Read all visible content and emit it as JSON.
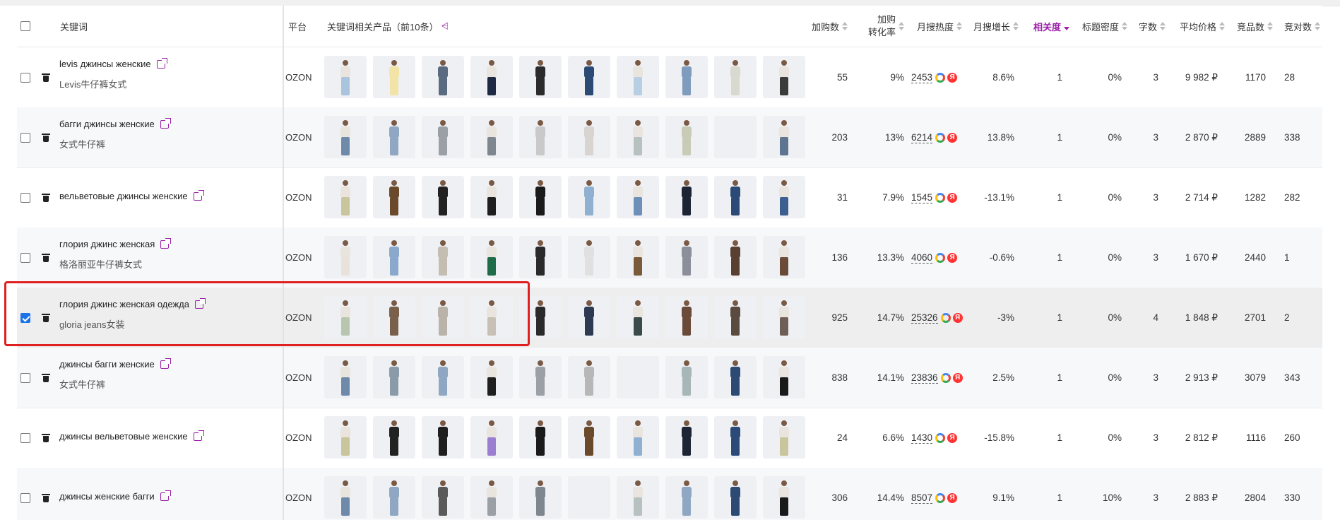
{
  "header": {
    "keyword": "关键词",
    "platform": "平台",
    "products": "关键词相关产品（前10条）",
    "add_to_cart": "加购数",
    "conversion_line1": "加购",
    "conversion_line2": "转化率",
    "monthly_heat": "月搜热度",
    "monthly_growth": "月搜增长",
    "relevance": "相关度",
    "title_density": "标题密度",
    "word_count": "字数",
    "avg_price": "平均价格",
    "competitors": "竞品数",
    "competition_ratio": "竞对数"
  },
  "rows": [
    {
      "keyword": "levis джинсы женские",
      "translation": "Levis牛仔裤女式",
      "platform": "OZON",
      "add": "55",
      "conv": "9%",
      "heat": "2453",
      "growth": "8.6%",
      "rel": "1",
      "density": "0%",
      "words": "3",
      "price": "9 982 ₽",
      "comp": "1170",
      "ratio": "28",
      "checked": false
    },
    {
      "keyword": "багги джинсы женские",
      "translation": "女式牛仔裤",
      "platform": "OZON",
      "add": "203",
      "conv": "13%",
      "heat": "6214",
      "growth": "13.8%",
      "rel": "1",
      "density": "0%",
      "words": "3",
      "price": "2 870 ₽",
      "comp": "2889",
      "ratio": "338",
      "checked": false
    },
    {
      "keyword": "вельветовые джинсы женские",
      "translation": "",
      "platform": "OZON",
      "add": "31",
      "conv": "7.9%",
      "heat": "1545",
      "growth": "-13.1%",
      "rel": "1",
      "density": "0%",
      "words": "3",
      "price": "2 714 ₽",
      "comp": "1282",
      "ratio": "282",
      "checked": false
    },
    {
      "keyword": "глория джинс женская",
      "translation": "格洛丽亚牛仔裤女式",
      "platform": "OZON",
      "add": "136",
      "conv": "13.3%",
      "heat": "4060",
      "growth": "-0.6%",
      "rel": "1",
      "density": "0%",
      "words": "3",
      "price": "1 670 ₽",
      "comp": "2440",
      "ratio": "1",
      "checked": false
    },
    {
      "keyword": "глория джинс женская одежда",
      "translation": "gloria jeans女装",
      "platform": "OZON",
      "add": "925",
      "conv": "14.7%",
      "heat": "25326",
      "growth": "-3%",
      "rel": "1",
      "density": "0%",
      "words": "4",
      "price": "1 848 ₽",
      "comp": "2701",
      "ratio": "2",
      "checked": true
    },
    {
      "keyword": "джинсы багги женские",
      "translation": "女式牛仔裤",
      "platform": "OZON",
      "add": "838",
      "conv": "14.1%",
      "heat": "23836",
      "growth": "2.5%",
      "rel": "1",
      "density": "0%",
      "words": "3",
      "price": "2 913 ₽",
      "comp": "3079",
      "ratio": "343",
      "checked": false
    },
    {
      "keyword": "джинсы вельветовые женские",
      "translation": "",
      "platform": "OZON",
      "add": "24",
      "conv": "6.6%",
      "heat": "1430",
      "growth": "-15.8%",
      "rel": "1",
      "density": "0%",
      "words": "3",
      "price": "2 812 ₽",
      "comp": "1116",
      "ratio": "260",
      "checked": false
    },
    {
      "keyword": "джинсы женские багги",
      "translation": "",
      "platform": "OZON",
      "add": "306",
      "conv": "14.4%",
      "heat": "8507",
      "growth": "9.1%",
      "rel": "1",
      "density": "10%",
      "words": "3",
      "price": "2 883 ₽",
      "comp": "2804",
      "ratio": "330",
      "checked": false
    }
  ],
  "thumb_palettes": [
    [
      "#a9c4dc",
      "#f2e4a6",
      "#5a6a80",
      "#1e2a44",
      "#2b2b2b",
      "#2d4a75",
      "#b8cfe3",
      "#7f9bbd",
      "#d9d9cf",
      "#3b3b3b"
    ],
    [
      "#6f8aa8",
      "#8fa7c2",
      "#9aa0a6",
      "#7e8690",
      "#c9c9c9",
      "#d8d4d0",
      "#b7c2c0",
      "#c9cbb6",
      "#eef0f3",
      "#5e7591"
    ],
    [
      "#c9c59c",
      "#6a4a2a",
      "#222",
      "#1f1f1f",
      "#1a1a1a",
      "#8fb0d0",
      "#6d8fb8",
      "#1d2433",
      "#2c4a78",
      "#3c5f8f"
    ],
    [
      "#e8e2da",
      "#8aa8cc",
      "#c4bdb2",
      "#1f6b4a",
      "#2a2a2a",
      "#e0e0e0",
      "#7a5a3a",
      "#8a8f99",
      "#5a4030",
      "#6a4a38"
    ],
    [
      "#b8c6b0",
      "#7a5f4a",
      "#b9b3aa",
      "#c8c0b4",
      "#2a2a2a",
      "#2d3a52",
      "#3b4a4a",
      "#6a4a38",
      "#5a4a40",
      "#6f5e55"
    ],
    [
      "#6f8aa8",
      "#8a9aa8",
      "#8fa7c2",
      "#1f1f1f",
      "#9aa0a6",
      "#b7b7b7",
      "#eef0f3",
      "#a7b7b8",
      "#2d4a75",
      "#1a1a1a"
    ],
    [
      "#c9c59c",
      "#222",
      "#1f1f1f",
      "#9a7fd0",
      "#1a1a1a",
      "#6a4a2a",
      "#8fb0d0",
      "#1d2433",
      "#2c4a78",
      "#c9c59c"
    ],
    [
      "#6f8aa8",
      "#8fa7c2",
      "#5a5a5a",
      "#9aa0a6",
      "#7e8690",
      "#eef0f3",
      "#b7c2c0",
      "#8fa7c2",
      "#2d4a75",
      "#1a1a1a"
    ]
  ]
}
